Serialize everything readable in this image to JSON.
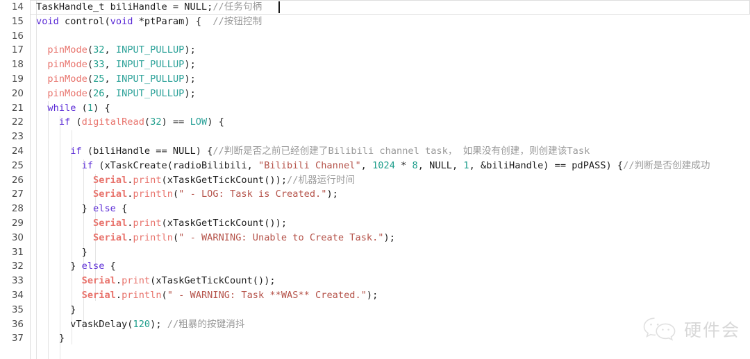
{
  "editor": {
    "first_line_number": 14,
    "active_line_number": 14,
    "language": "cpp",
    "colors": {
      "background": "#ffffff",
      "gutter_text": "#4a4a4a",
      "gutter_border": "#dcdcdc",
      "keyword": "#5b2bd6",
      "function": "#e8736c",
      "object": "#e8736c",
      "number": "#1f9e8c",
      "constant": "#2aa198",
      "string": "#b5534a",
      "comment": "#9a9a9a",
      "plain": "#1c1c1c",
      "indent_guide": "#e4e4e4",
      "active_line_border": "#dedede"
    }
  },
  "lines": [
    {
      "n": "14",
      "text": "TaskHandle_t biliHandle = NULL;//任务句柄"
    },
    {
      "n": "15",
      "text": "void control(void *ptParam) {  //按钮控制"
    },
    {
      "n": "16",
      "text": ""
    },
    {
      "n": "17",
      "text": "  pinMode(32, INPUT_PULLUP);"
    },
    {
      "n": "18",
      "text": "  pinMode(33, INPUT_PULLUP);"
    },
    {
      "n": "19",
      "text": "  pinMode(25, INPUT_PULLUP);"
    },
    {
      "n": "20",
      "text": "  pinMode(26, INPUT_PULLUP);"
    },
    {
      "n": "21",
      "text": "  while (1) {"
    },
    {
      "n": "22",
      "text": "    if (digitalRead(32) == LOW) {"
    },
    {
      "n": "23",
      "text": ""
    },
    {
      "n": "24",
      "text": "      if (biliHandle == NULL) {//判断是否之前已经创建了Bilibili channel task， 如果没有创建，则创建该Task"
    },
    {
      "n": "25",
      "text": "        if (xTaskCreate(radioBilibili, \"Bilibili Channel\", 1024 * 8, NULL, 1, &biliHandle) == pdPASS) {//判断是否创建成功"
    },
    {
      "n": "26",
      "text": "          Serial.print(xTaskGetTickCount());//机器运行时间"
    },
    {
      "n": "27",
      "text": "          Serial.println(\" - LOG: Task is Created.\");"
    },
    {
      "n": "28",
      "text": "        } else {"
    },
    {
      "n": "29",
      "text": "          Serial.print(xTaskGetTickCount());"
    },
    {
      "n": "30",
      "text": "          Serial.println(\" - WARNING: Unable to Create Task.\");"
    },
    {
      "n": "31",
      "text": "        }"
    },
    {
      "n": "32",
      "text": "      } else {"
    },
    {
      "n": "33",
      "text": "        Serial.print(xTaskGetTickCount());"
    },
    {
      "n": "34",
      "text": "        Serial.println(\" - WARNING: Task **WAS** Created.\");"
    },
    {
      "n": "35",
      "text": "      }"
    },
    {
      "n": "36",
      "text": "      vTaskDelay(120); //粗暴的按键消抖"
    },
    {
      "n": "37",
      "text": "    }"
    }
  ],
  "watermark": {
    "icon": "wechat-icon",
    "label": "硬件会",
    "color": "#b3b3b3"
  }
}
